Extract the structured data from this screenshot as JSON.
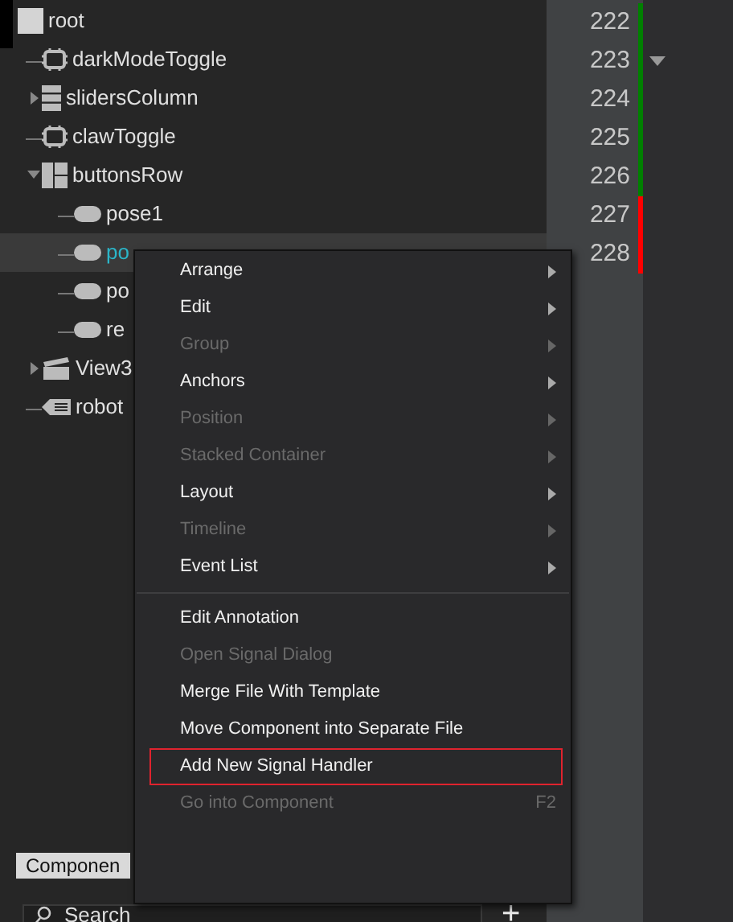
{
  "tree": [
    {
      "label": "root",
      "kind": "item",
      "selected": false,
      "children": [
        {
          "label": "darkModeToggle",
          "kind": "switch",
          "selected": false
        },
        {
          "label": "slidersColumn",
          "kind": "column",
          "selected": false,
          "expanded": false
        },
        {
          "label": "clawToggle",
          "kind": "switch",
          "selected": false
        },
        {
          "label": "buttonsRow",
          "kind": "row",
          "selected": false,
          "expanded": true,
          "children": [
            {
              "label": "pose1",
              "kind": "button",
              "selected": false
            },
            {
              "label": "po",
              "kind": "button",
              "selected": true
            },
            {
              "label": "po",
              "kind": "button",
              "selected": false
            },
            {
              "label": "re",
              "kind": "button",
              "selected": false
            }
          ]
        },
        {
          "label": "View3",
          "kind": "view",
          "selected": false,
          "expanded": false
        },
        {
          "label": "robot",
          "kind": "tag",
          "selected": false
        }
      ]
    }
  ],
  "gutter": {
    "lines": [
      {
        "number": "222",
        "color": "#008000",
        "foldable": false
      },
      {
        "number": "223",
        "color": "#008000",
        "foldable": true
      },
      {
        "number": "224",
        "color": "#008000",
        "foldable": false
      },
      {
        "number": "225",
        "color": "#008000",
        "foldable": false
      },
      {
        "number": "226",
        "color": "#008000",
        "foldable": false
      },
      {
        "number": "227",
        "color": "#ff0000",
        "foldable": false
      },
      {
        "number": "228",
        "color": "#ff0000",
        "foldable": false
      }
    ]
  },
  "context_menu": {
    "groups": [
      [
        {
          "label": "Arrange",
          "disabled": false,
          "submenu": true
        },
        {
          "label": "Edit",
          "disabled": false,
          "submenu": true
        },
        {
          "label": "Group",
          "disabled": true,
          "submenu": true
        },
        {
          "label": "Anchors",
          "disabled": false,
          "submenu": true
        },
        {
          "label": "Position",
          "disabled": true,
          "submenu": true
        },
        {
          "label": "Stacked Container",
          "disabled": true,
          "submenu": true
        },
        {
          "label": "Layout",
          "disabled": false,
          "submenu": true
        },
        {
          "label": "Timeline",
          "disabled": true,
          "submenu": true
        },
        {
          "label": "Event List",
          "disabled": false,
          "submenu": true
        }
      ],
      [
        {
          "label": "Edit Annotation",
          "disabled": false,
          "submenu": false
        },
        {
          "label": "Open Signal Dialog",
          "disabled": true,
          "submenu": false
        },
        {
          "label": "Merge File With Template",
          "disabled": false,
          "submenu": false
        },
        {
          "label": "Move Component into Separate File",
          "disabled": false,
          "submenu": false
        },
        {
          "label": "Add New Signal Handler",
          "disabled": false,
          "submenu": false,
          "outlined": true
        },
        {
          "label": "Go into Component",
          "disabled": true,
          "submenu": false,
          "shortcut": "F2"
        }
      ]
    ]
  },
  "bottom_tab": {
    "label": "Componen"
  },
  "search": {
    "placeholder": "Search",
    "add_button": "+"
  }
}
